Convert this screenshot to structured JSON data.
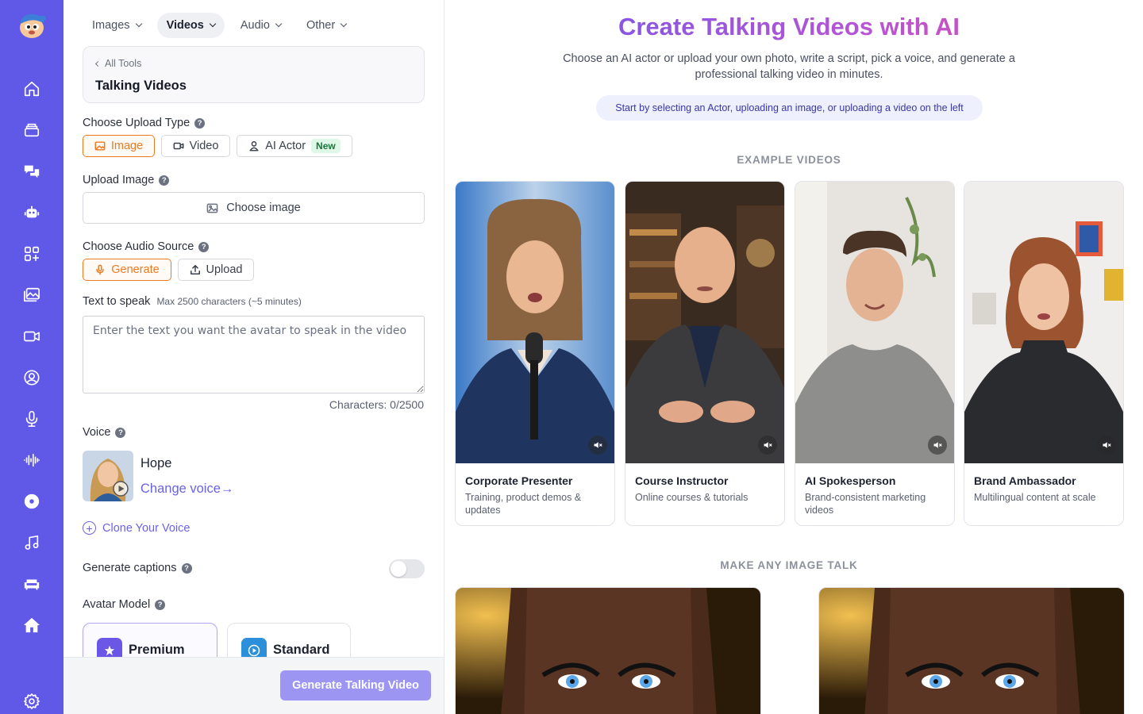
{
  "rail": {
    "icons": [
      "home-icon",
      "stack-icon",
      "chat-icon",
      "robot-icon",
      "apps-icon",
      "gallery-icon",
      "video-icon",
      "user-circle-icon",
      "microphone-icon",
      "waveform-icon",
      "disc-icon",
      "music-icon",
      "sofa-icon",
      "house-icon",
      "gear-icon"
    ]
  },
  "topnav": {
    "items": [
      "Images",
      "Videos",
      "Audio",
      "Other"
    ],
    "active": "Videos"
  },
  "breadcrumb": {
    "back_label": "All Tools",
    "title": "Talking Videos"
  },
  "upload_type": {
    "label": "Choose Upload Type",
    "options": [
      "Image",
      "Video",
      "AI Actor"
    ],
    "selected": "Image",
    "new_badge": "New"
  },
  "upload_image": {
    "label": "Upload Image",
    "button": "Choose image"
  },
  "audio_source": {
    "label": "Choose Audio Source",
    "options": [
      "Generate",
      "Upload"
    ],
    "selected": "Generate"
  },
  "text_to_speak": {
    "label": "Text to speak",
    "sublabel": "Max 2500 characters (~5 minutes)",
    "placeholder": "Enter the text you want the avatar to speak in the video",
    "char_count": "Characters: 0/2500"
  },
  "voice": {
    "label": "Voice",
    "name": "Hope",
    "change_label": "Change voice→"
  },
  "clone_voice": "Clone Your Voice",
  "captions": {
    "label": "Generate captions",
    "enabled": false
  },
  "avatar_model": {
    "label": "Avatar Model",
    "options": [
      "Premium",
      "Standard"
    ],
    "selected": "Premium"
  },
  "generate_button": "Generate Talking Video",
  "hero": {
    "title": "Create Talking Videos with AI",
    "subtitle": "Choose an AI actor or upload your own photo, write a script, pick a voice, and generate a professional talking video in minutes.",
    "hint": "Start by selecting an Actor, uploading an image, or uploading a video on the left"
  },
  "examples": {
    "heading": "EXAMPLE VIDEOS",
    "cards": [
      {
        "title": "Corporate Presenter",
        "desc": "Training, product demos & updates"
      },
      {
        "title": "Course Instructor",
        "desc": "Online courses & tutorials"
      },
      {
        "title": "AI Spokesperson",
        "desc": "Brand-consistent marketing videos"
      },
      {
        "title": "Brand Ambassador",
        "desc": "Multilingual content at scale"
      }
    ]
  },
  "make_image_talk": {
    "heading": "MAKE ANY IMAGE TALK"
  },
  "colors": {
    "rail": "#6059e8",
    "accent_orange": "#ee7a1f",
    "accent_purple": "#6b62e6",
    "generate_button": "#9c95f2"
  }
}
